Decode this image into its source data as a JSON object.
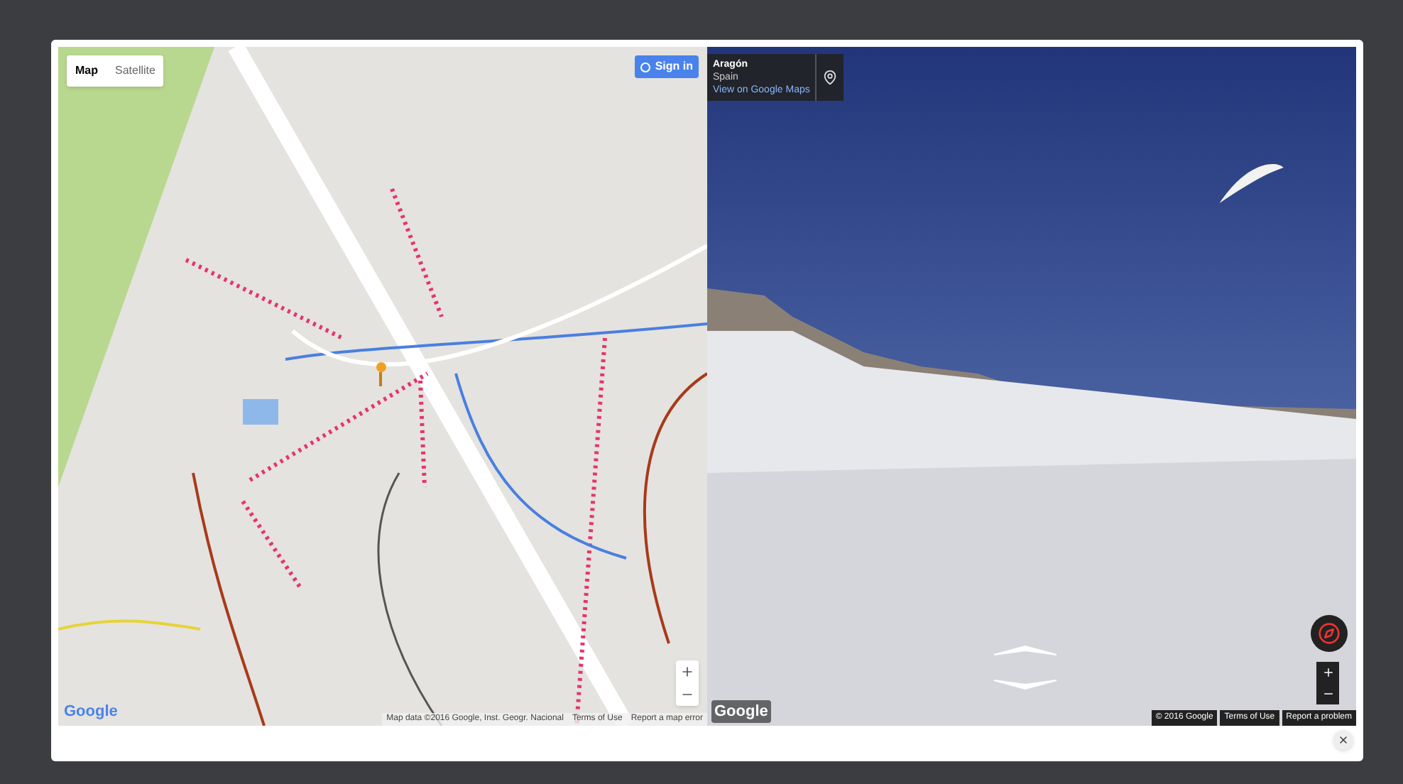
{
  "map": {
    "type_tabs": [
      {
        "label": "Map",
        "selected": true
      },
      {
        "label": "Satellite",
        "selected": false
      }
    ],
    "sign_in": "Sign in",
    "attribution": "Map data ©2016 Google, Inst. Geogr. Nacional",
    "terms": "Terms of Use",
    "report": "Report a map error",
    "logo": "Google"
  },
  "street_view": {
    "place": "Aragón",
    "region": "Spain",
    "link": "View on Google Maps",
    "copyright": "© 2016 Google",
    "terms": "Terms of Use",
    "report": "Report a problem",
    "logo": "Google"
  }
}
